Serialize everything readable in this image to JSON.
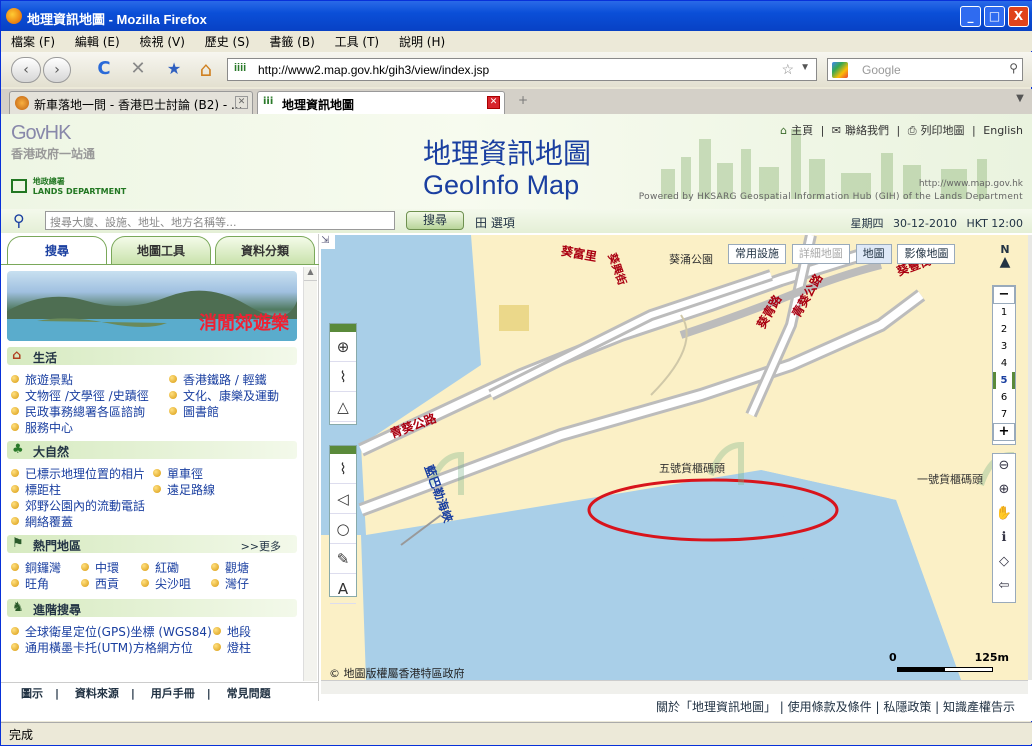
{
  "window": {
    "title": "地理資訊地圖 - Mozilla Firefox",
    "min": "_",
    "max": "□",
    "close": "X"
  },
  "menu": [
    "檔案 (F)",
    "編輯 (E)",
    "檢視 (V)",
    "歷史 (S)",
    "書籤 (B)",
    "工具 (T)",
    "說明 (H)"
  ],
  "nav": {
    "back": "‹",
    "forward": "›",
    "reload": "C",
    "stop": "✕",
    "home": "⌂"
  },
  "url": "http://www2.map.gov.hk/gih3/view/index.jsp",
  "search_placeholder": "Google",
  "tabs": [
    {
      "label": "新車落地一問 - 香港巴士討論 (B2) - ..."
    },
    {
      "label": "地理資訊地圖"
    }
  ],
  "header": {
    "govhk": "GovHK",
    "govhk_zh": "香港政府一站通",
    "lands_zh": "地政總署",
    "lands_en": "LANDS DEPARTMENT",
    "title_zh": "地理資訊地圖",
    "title_en": "GeoInfo Map",
    "links": [
      "主頁",
      "聯絡我們",
      "列印地圖",
      "English"
    ],
    "map_url": "http://www.map.gov.hk",
    "powered": "Powered by HKSARG Geospatial Information Hub (GIH) of the Lands Department"
  },
  "search": {
    "placeholder": "搜尋大廈、設施、地址、地方名稱等...",
    "button": "搜尋",
    "options": "田 選項",
    "weekday": "星期四",
    "date": "30-12-2010",
    "time": "HKT 12:00"
  },
  "left_tabs": [
    "搜尋",
    "地圖工具",
    "資料分類"
  ],
  "banner": "消閒郊遊樂",
  "sections": {
    "life": {
      "title": "生活",
      "items": [
        "旅遊景點",
        "香港鐵路 / 輕鐵",
        "文物徑 /文學徑 /史蹟徑",
        "文化、康樂及運動",
        "民政事務總署各區諮詢",
        "服務中心",
        "圖書館"
      ]
    },
    "nature": {
      "title": "大自然",
      "items": [
        "已標示地理位置的相片",
        "單車徑",
        "標距柱",
        "遠足路線",
        "郊野公園內的流動電話",
        "網絡覆蓋"
      ]
    },
    "hot": {
      "title": "熱門地區",
      "more": ">>更多",
      "items": [
        "銅鑼灣",
        "中環",
        "紅磡",
        "觀塘",
        "旺角",
        "西貢",
        "尖沙咀",
        "灣仔"
      ]
    },
    "adv": {
      "title": "進階搜尋",
      "items": [
        "全球衛星定位(GPS)坐標 (WGS84)",
        "地段",
        "通用橫墨卡托(UTM)方格網方位",
        "燈柱"
      ]
    }
  },
  "left_footer": [
    "圖示",
    "資料來源",
    "用戶手冊",
    "常見問題"
  ],
  "map": {
    "layers": [
      "常用設施",
      "詳細地圖",
      "地圖",
      "影像地圖"
    ],
    "north": "N",
    "zoom_levels": [
      "1",
      "2",
      "3",
      "4",
      "5",
      "6",
      "7"
    ],
    "zoom_minus": "−",
    "zoom_plus": "+",
    "labels": {
      "kwai_chung_park": "葵涌公園",
      "kwai_foo": "葵富里",
      "kwai_hing": "葵興街",
      "road1": "青葵公路",
      "road2": "葵青路",
      "channel": "藍巴勒海峽",
      "ct5": "五號貨櫃碼頭",
      "ct1": "一號貨櫃碼頭",
      "kwai_fung": "葵豐街"
    },
    "copyright": "© 地圖版權屬香港特區政府",
    "scale_start": "0",
    "scale_end": "125m"
  },
  "footer_links": "關於「地理資訊地圖」 | 使用條款及條件 | 私隱政策 | 知識產權告示",
  "status": "完成"
}
